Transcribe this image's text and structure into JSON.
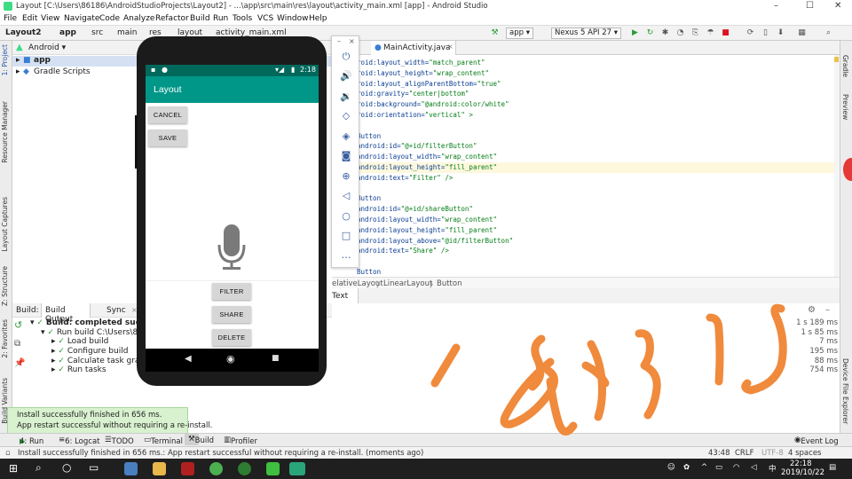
{
  "window": {
    "title": "Layout [C:\\Users\\86186\\AndroidStudioProjects\\Layout2] - ...\\app\\src\\main\\res\\layout\\activity_main.xml [app] - Android Studio",
    "minimize": "–",
    "maximize": "☐",
    "close": "✕"
  },
  "menu": [
    "File",
    "Edit",
    "View",
    "Navigate",
    "Code",
    "Analyze",
    "Refactor",
    "Build",
    "Run",
    "Tools",
    "VCS",
    "Window",
    "Help"
  ],
  "nav": {
    "breadcrumbs": [
      "Layout2",
      "app",
      "src",
      "main",
      "res",
      "layout",
      "activity_main.xml"
    ],
    "run_config": "app",
    "device": "Nexus 5 API 27"
  },
  "left_strip": [
    "1: Project",
    "Resource Manager",
    "Layout Captures",
    "Z: Structure",
    "2: Favorites",
    "Build Variants"
  ],
  "right_strip": [
    "Gradle",
    "Preview",
    "Device File Explorer"
  ],
  "project": {
    "view": "Android",
    "items": [
      "app",
      "Gradle Scripts"
    ]
  },
  "editor": {
    "tab": "MainActivity.java",
    "lines": [
      {
        "k": "roid:layout_width=",
        "v": "\"match_parent\""
      },
      {
        "k": "roid:layout_height=",
        "v": "\"wrap_content\""
      },
      {
        "k": "roid:layout_alignParentBottom=",
        "v": "\"true\""
      },
      {
        "k": "roid:gravity=",
        "v": "\"center|bottom\""
      },
      {
        "k": "roid:background=",
        "v": "\"@android:color/white\""
      },
      {
        "k": "roid:orientation=",
        "v": "\"vertical\" >"
      },
      {
        "k": "",
        "v": ""
      },
      {
        "k": "Button",
        "v": ""
      },
      {
        "k": " android:id=",
        "v": "\"@+id/filterButton\""
      },
      {
        "k": " android:layout_width=",
        "v": "\"wrap_content\""
      },
      {
        "k": " android:layout_height=",
        "v": "\"fill_parent\""
      },
      {
        "k": " android:text=",
        "v": "\"Filter\" />"
      },
      {
        "k": "",
        "v": ""
      },
      {
        "k": "Button",
        "v": ""
      },
      {
        "k": " android:id=",
        "v": "\"@+id/shareButton\""
      },
      {
        "k": " android:layout_width=",
        "v": "\"wrap_content\""
      },
      {
        "k": " android:layout_height=",
        "v": "\"fill_parent\""
      },
      {
        "k": " android:layout_above=",
        "v": "\"@id/filterButton\""
      },
      {
        "k": " android:text=",
        "v": "\"Share\" />"
      },
      {
        "k": "",
        "v": ""
      },
      {
        "k": "Button",
        "v": ""
      }
    ],
    "breadcrumb": [
      "elativeLayout",
      "LinearLayout",
      "Button"
    ],
    "subtab": "Text"
  },
  "build": {
    "label": "Build:",
    "tabs": [
      "Build Output",
      "Sync"
    ],
    "rows": [
      {
        "text": "Build: completed successful",
        "bold": true
      },
      {
        "text": "Run build C:\\Users\\86186"
      },
      {
        "text": "Load build"
      },
      {
        "text": "Configure build"
      },
      {
        "text": "Calculate task graph"
      },
      {
        "text": "Run tasks"
      }
    ],
    "times": [
      "1 s 189 ms",
      "1 s 85 ms",
      "7 ms",
      "195 ms",
      "88 ms",
      "754 ms"
    ]
  },
  "toast": {
    "line1": "Install successfully finished in 656 ms.",
    "line2": "App restart successful without requiring a re-install."
  },
  "bottom_tabs": [
    "4: Run",
    "6: Logcat",
    "TODO",
    "Terminal",
    "Build",
    "Profiler"
  ],
  "event_log": "Event Log",
  "status": {
    "message": "Install successfully finished in 656 ms.: App restart successful without requiring a re-install. (moments ago)",
    "position": "43:48",
    "line_sep": "CRLF",
    "encoding": "UTF-8",
    "indent": "4 spaces"
  },
  "phone": {
    "time": "2:18",
    "app_title": "Layout",
    "buttons_top": [
      "CANCEL",
      "SAVE"
    ],
    "buttons_bottom": [
      "FILTER",
      "SHARE",
      "DELETE"
    ],
    "mic_icon": "microphone-icon",
    "primary": "#009688",
    "primary_dark": "#00695c"
  },
  "taskbar": {
    "time": "22:18",
    "date": "2019/10/22",
    "ime": "中"
  },
  "colors": {
    "scribble": "#f08a3c",
    "toast_bg": "#d8f1cf"
  }
}
